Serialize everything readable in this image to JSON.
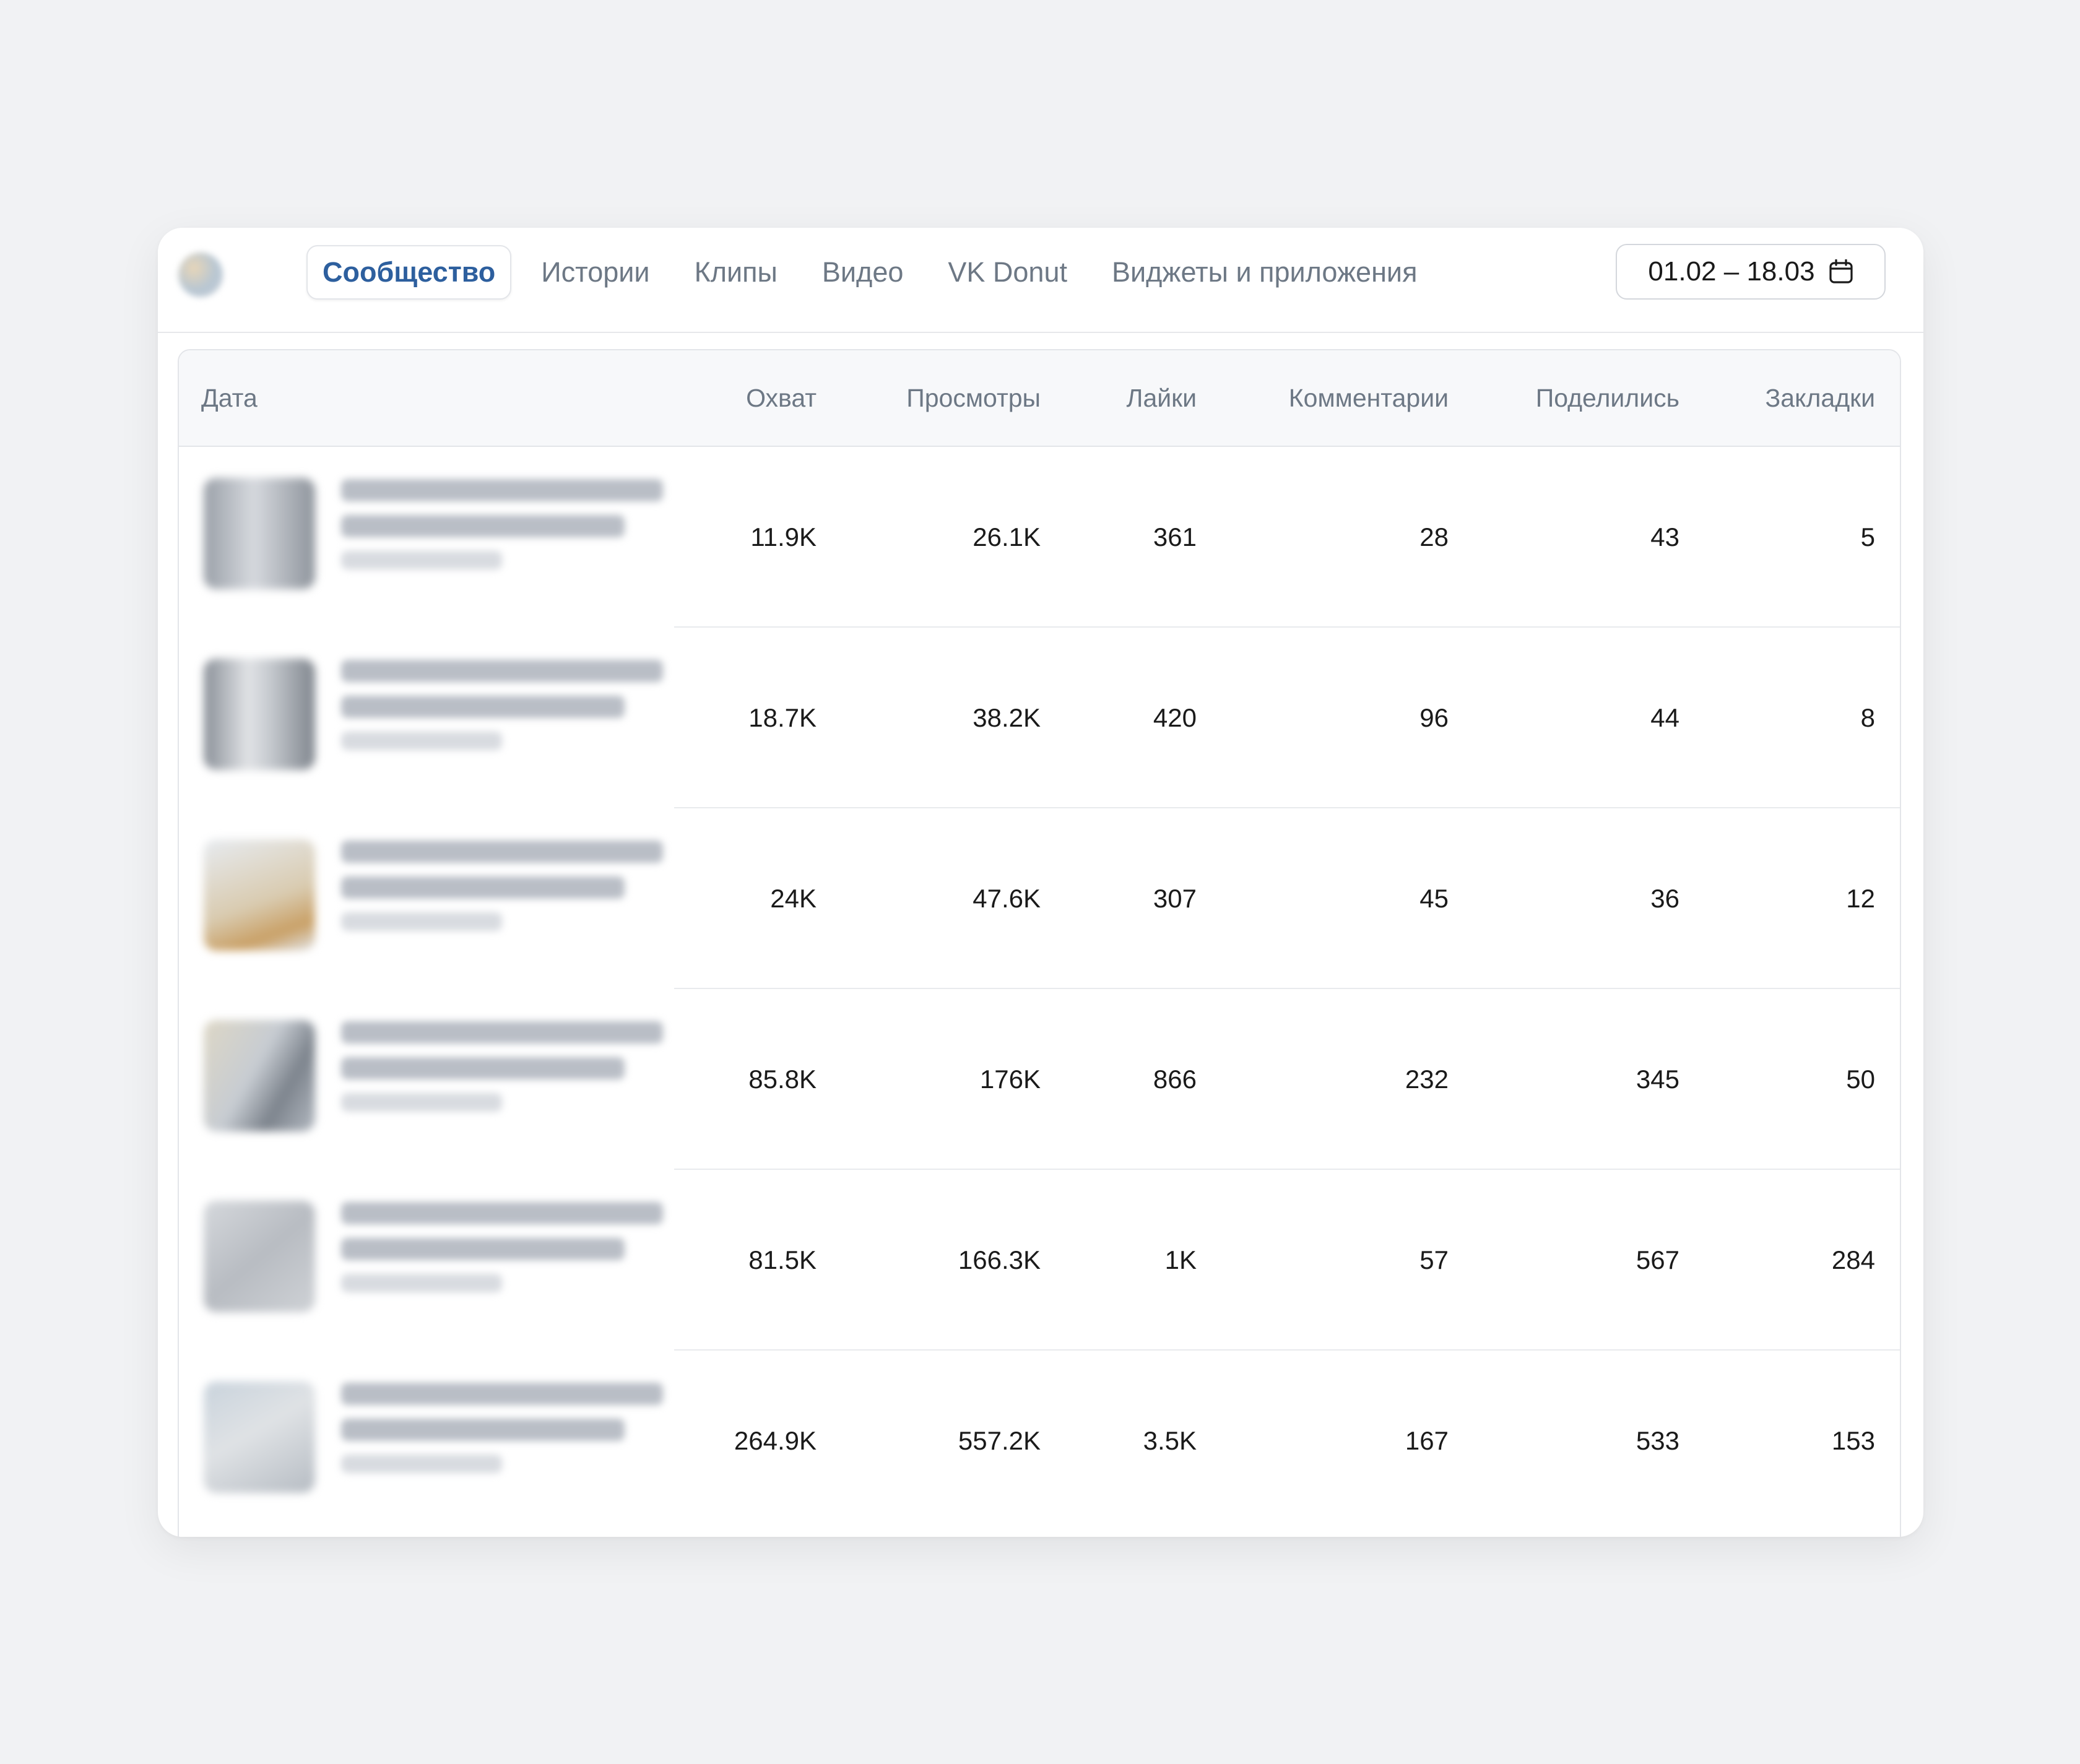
{
  "tabs": [
    {
      "label": "Сообщество",
      "active": true
    },
    {
      "label": "Истории",
      "active": false
    },
    {
      "label": "Клипы",
      "active": false
    },
    {
      "label": "Видео",
      "active": false
    },
    {
      "label": "VK Donut",
      "active": false
    },
    {
      "label": "Виджеты и приложения",
      "active": false
    }
  ],
  "date_range": {
    "label": "01.02 – 18.03",
    "icon": "calendar-icon"
  },
  "table": {
    "columns": [
      "Дата",
      "Охват",
      "Просмотры",
      "Лайки",
      "Комментарии",
      "Поделились",
      "Закладки"
    ],
    "rows": [
      {
        "reach": "11.9K",
        "views": "26.1K",
        "likes": "361",
        "comments": "28",
        "shares": "43",
        "bookmarks": "5"
      },
      {
        "reach": "18.7K",
        "views": "38.2K",
        "likes": "420",
        "comments": "96",
        "shares": "44",
        "bookmarks": "8"
      },
      {
        "reach": "24K",
        "views": "47.6K",
        "likes": "307",
        "comments": "45",
        "shares": "36",
        "bookmarks": "12"
      },
      {
        "reach": "85.8K",
        "views": "176K",
        "likes": "866",
        "comments": "232",
        "shares": "345",
        "bookmarks": "50"
      },
      {
        "reach": "81.5K",
        "views": "166.3K",
        "likes": "1K",
        "comments": "57",
        "shares": "567",
        "bookmarks": "284"
      },
      {
        "reach": "264.9K",
        "views": "557.2K",
        "likes": "3.5K",
        "comments": "167",
        "shares": "533",
        "bookmarks": "153"
      }
    ]
  }
}
